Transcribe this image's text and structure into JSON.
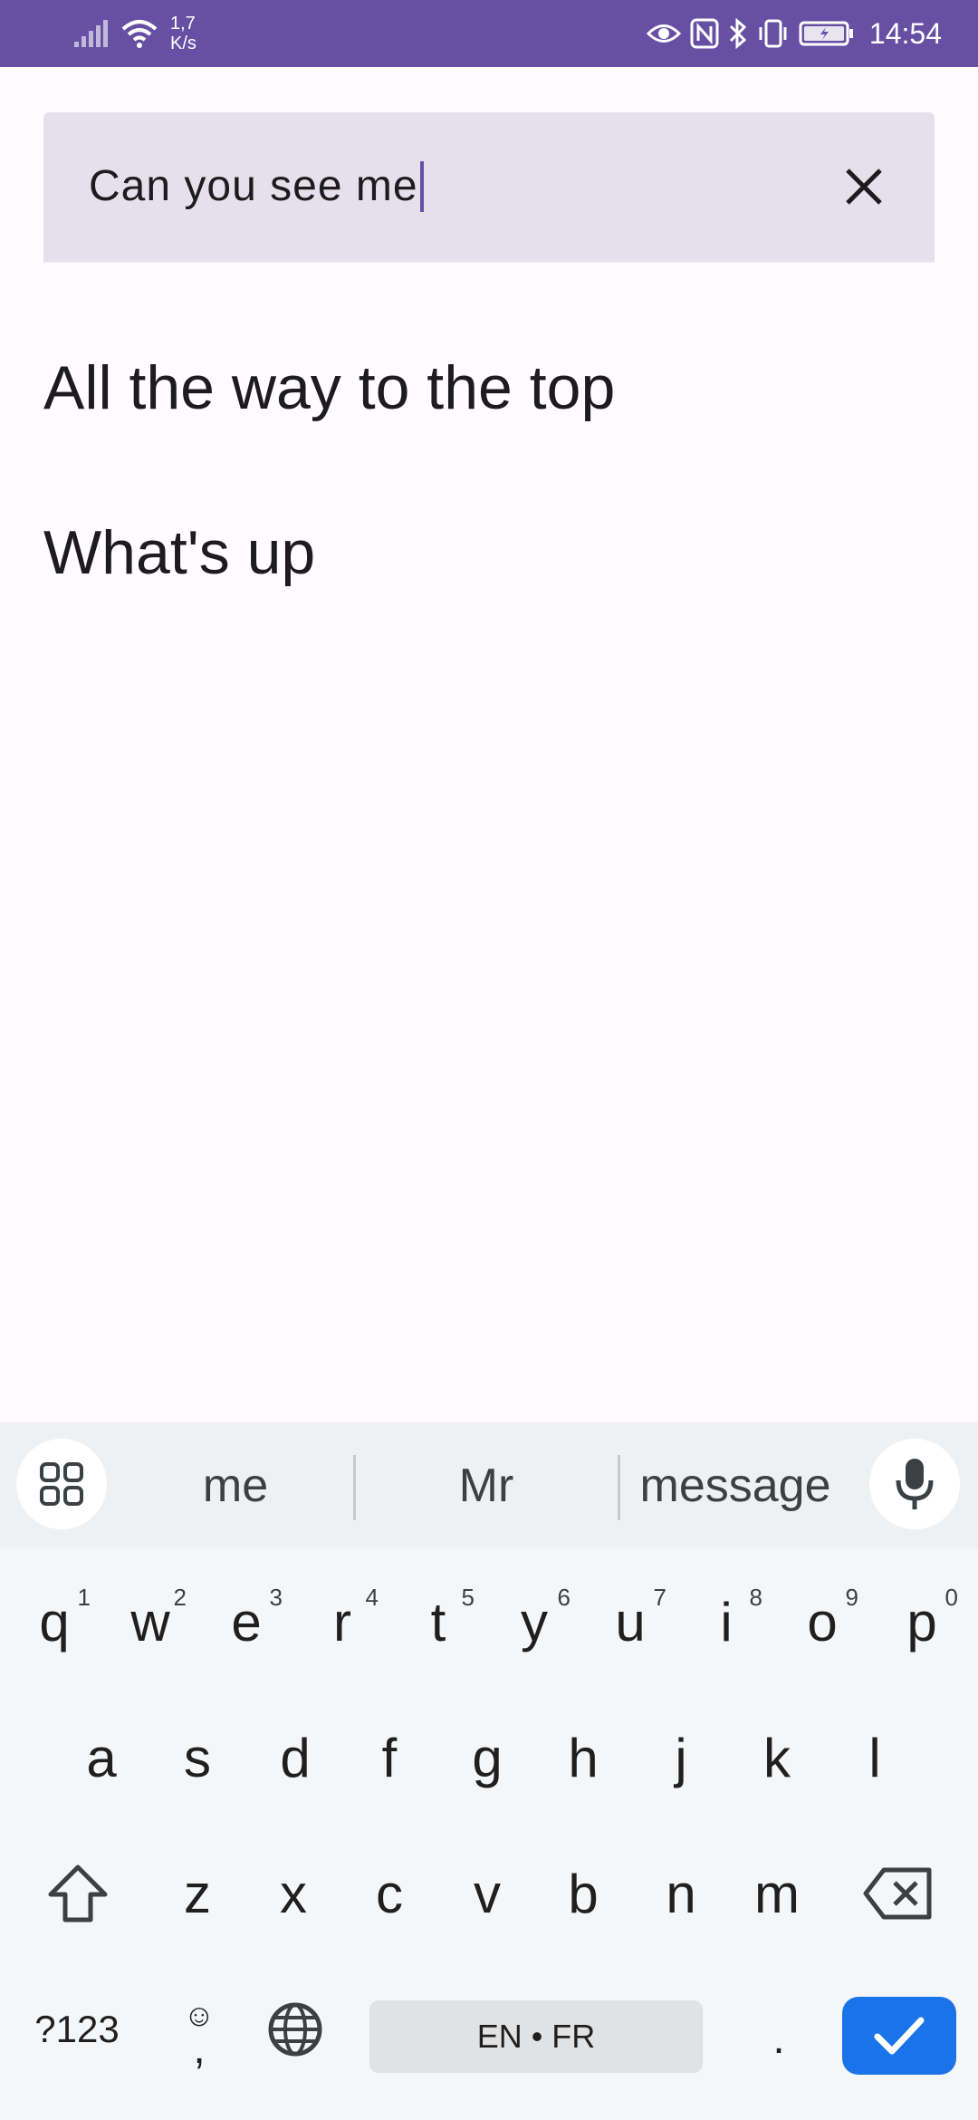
{
  "status_bar": {
    "speed_value": "1,7",
    "speed_unit": "K/s",
    "time": "14:54",
    "icons": [
      "signal-icon",
      "wifi-icon",
      "eye-icon",
      "nfc-icon",
      "bluetooth-icon",
      "vibrate-icon",
      "battery-charging-icon"
    ],
    "background": "#6750A4"
  },
  "search": {
    "query": "Can you see me",
    "clear_icon": "close-icon"
  },
  "results": [
    {
      "label": "All the way to the top"
    },
    {
      "label": "What's up"
    }
  ],
  "keyboard": {
    "suggestions": [
      "me",
      "Mr",
      "message"
    ],
    "row1": [
      {
        "label": "q",
        "hint": "1"
      },
      {
        "label": "w",
        "hint": "2"
      },
      {
        "label": "e",
        "hint": "3"
      },
      {
        "label": "r",
        "hint": "4"
      },
      {
        "label": "t",
        "hint": "5"
      },
      {
        "label": "y",
        "hint": "6"
      },
      {
        "label": "u",
        "hint": "7"
      },
      {
        "label": "i",
        "hint": "8"
      },
      {
        "label": "o",
        "hint": "9"
      },
      {
        "label": "p",
        "hint": "0"
      }
    ],
    "row2": [
      "a",
      "s",
      "d",
      "f",
      "g",
      "h",
      "j",
      "k",
      "l"
    ],
    "row3": [
      "z",
      "x",
      "c",
      "v",
      "b",
      "n",
      "m"
    ],
    "symbols_label": "?123",
    "emoji_top": "☺",
    "emoji_bottom": ",",
    "space_label": "EN • FR",
    "period_label": ".",
    "accent": "#1A73E8"
  }
}
